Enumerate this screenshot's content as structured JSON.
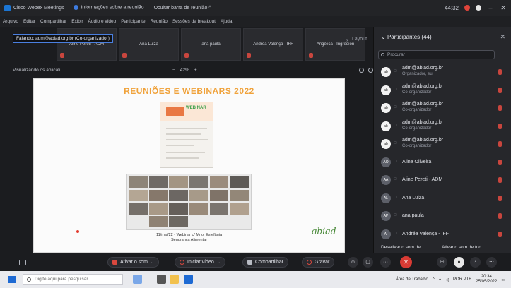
{
  "titlebar": {
    "app_title": "Cisco Webex Meetings",
    "info_label": "Informações sobre a reunião",
    "hide_label": "Ocultar barra de reunião ^",
    "time": "44:32",
    "min": "–",
    "close": "✕"
  },
  "menu": [
    "Arquivo",
    "Editar",
    "Compartilhar",
    "Exibir",
    "Áudio e vídeo",
    "Participante",
    "Reunião",
    "Sessões de breakout",
    "Ajuda"
  ],
  "speaking_banner": "Falando: adm@abiad.org.br (Co-organizador)",
  "thumbnails": [
    {
      "name": "Aline Pereti - ADM"
    },
    {
      "name": "Ana Luiza"
    },
    {
      "name": "ana paula"
    },
    {
      "name": "Andrea Valença - IFF"
    },
    {
      "name": "Angélica - Ingredion"
    }
  ],
  "strip_label": "Layout",
  "viewbar": {
    "viewing": "Visualizando os aplicati...",
    "zoom_out": "−",
    "zoom_value": "42%",
    "zoom_in": "+"
  },
  "slide": {
    "title": "REUNIÕES E WEBINARS 2022",
    "poster_word": "WEB NAR",
    "caption_line1": "11/mai/22 - Webinar c/ Mrio. Estefânia",
    "caption_line2": "Segurança Alimentar",
    "brand": "abiad"
  },
  "participants_panel": {
    "header": "Participantes (44)",
    "search_placeholder": "Procurar",
    "items": [
      {
        "name": "adm@abiad.org.br",
        "role": "Organizador, eu",
        "initials": "ab"
      },
      {
        "name": "adm@abiad.org.br",
        "role": "Co-organizador",
        "initials": "ab"
      },
      {
        "name": "adm@abiad.org.br",
        "role": "Co-organizador",
        "initials": "ab"
      },
      {
        "name": "adm@abiad.org.br",
        "role": "Co-organizador",
        "initials": "ab"
      },
      {
        "name": "adm@abiad.org.br",
        "role": "Co-organizador",
        "initials": "ab"
      },
      {
        "name": "Aline Oliveira",
        "role": "",
        "initials": "AO"
      },
      {
        "name": "Aline Pereti - ADM",
        "role": "",
        "initials": "AA"
      },
      {
        "name": "Ana Luiza",
        "role": "",
        "initials": "AL"
      },
      {
        "name": "ana paula",
        "role": "",
        "initials": "AP"
      },
      {
        "name": "Andréa Valença - IFF",
        "role": "",
        "initials": "AI"
      }
    ],
    "mute_all": "Desativar o som de ...",
    "mute_everyone": "Ativar o som de tod..."
  },
  "toolbar": {
    "mute": "Ativar o som",
    "video": "Iniciar vídeo",
    "share": "Compartilhar",
    "record": "Gravar",
    "more": "···"
  },
  "taskbar": {
    "search_placeholder": "Digite aqui para pesquisar",
    "workspace": "Área de Trabalho",
    "lang": "POR PTB",
    "time": "20:34",
    "date": "25/05/2022"
  },
  "colors": {
    "accent": "#4a7fe0",
    "danger": "#d93b34",
    "slide_title": "#f0a23a",
    "brand": "#4a8a3a"
  }
}
